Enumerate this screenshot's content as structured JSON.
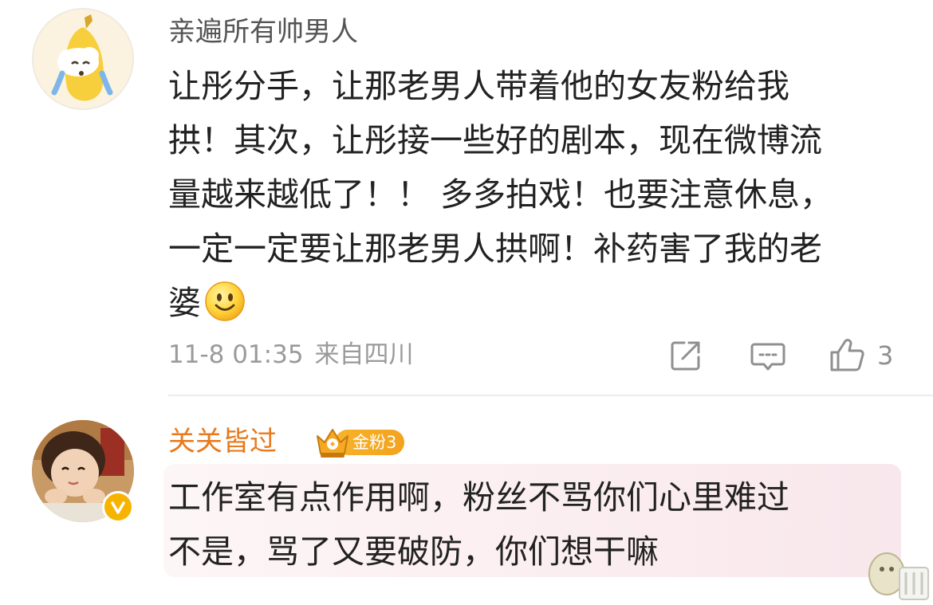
{
  "comments": [
    {
      "username": "亲遍所有帅男人",
      "text_lines": [
        "让彤分手，让那老男人带着他的女友粉给我",
        "拱！其次，让彤接一些好的剧本，现在微博流",
        "量越来越低了！！ 多多拍戏！也要注意休息，",
        "一定一定要让那老男人拱啊！补药害了我的老",
        "婆"
      ],
      "emoji": "smile-emoji",
      "date": "11-8 01:35",
      "location": "来自四川",
      "like_count": "3",
      "actions": [
        "share-icon",
        "reply-icon",
        "like-icon"
      ]
    },
    {
      "username": "关关皆过",
      "fan_badge": "金粉3",
      "text_lines": [
        "工作室有点作用啊，粉丝不骂你们心里难过",
        "不是，骂了又要破防，你们想干嘛"
      ],
      "verified": true
    }
  ],
  "colors": {
    "username_default": "#555555",
    "username_fan": "#e8791c",
    "meta": "#9a9a9a",
    "badge_gold": "#f6b400",
    "highlight_pink": "#fbeef0"
  }
}
